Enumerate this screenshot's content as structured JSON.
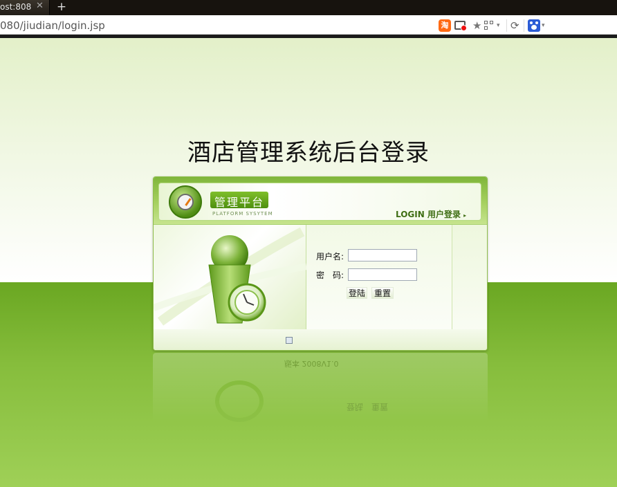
{
  "browser": {
    "tab_title": "ost:808",
    "tab_close": "✕",
    "new_tab": "+",
    "url": "080/jiudian/login.jsp",
    "icons": {
      "shop": "taobao-icon",
      "adblock": "adblock-icon",
      "bookmark": "star-icon",
      "qrcode": "qr-code-icon",
      "reload": "reload-icon",
      "search_engine": "baidu-paw-icon"
    },
    "shop_glyph": "淘",
    "star_glyph": "★",
    "reload_glyph": "⟳",
    "dropdown_glyph": "▾"
  },
  "page": {
    "title": "酒店管理系统后台登录"
  },
  "panel": {
    "brand": "管理平台",
    "brand_sub": "PLATFORM SYSYTEM",
    "login_tag": "LOGIN 用户登录",
    "login_arrow": "▸",
    "username_label": "用户名:",
    "password_label": "密　码:",
    "username_value": "",
    "password_value": "",
    "login_button": "登陆",
    "reset_button": "重置"
  },
  "reflection": {
    "footer_text": "版本 2008V1.0",
    "buttons": "登陆　重置"
  },
  "colors": {
    "accent": "#7fb63a",
    "page_green": "#6aa722",
    "brand_box": "#4e8f0f"
  }
}
